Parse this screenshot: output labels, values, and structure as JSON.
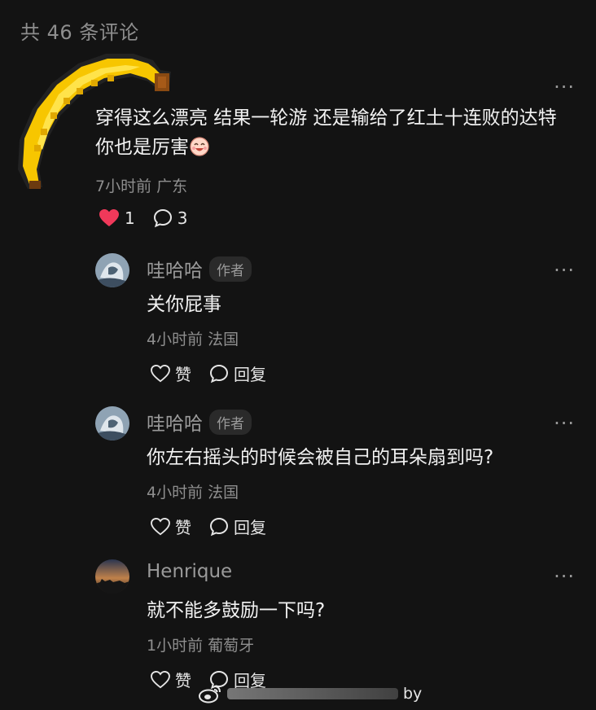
{
  "header": {
    "title": "共 46 条评论"
  },
  "main_comment": {
    "text": "穿得这么漂亮 结果一轮游 还是输给了红土十连败的达特 你也是厉害",
    "emoji": "laughing-face-emoji",
    "meta": "7小时前 广东",
    "likes": "1",
    "replies": "3",
    "more": "···"
  },
  "replies": [
    {
      "name": "哇哈哈",
      "badge": "作者",
      "text": "关你屁事",
      "meta": "4小时前 法国",
      "like_label": "赞",
      "reply_label": "回复",
      "more": "···"
    },
    {
      "name": "哇哈哈",
      "badge": "作者",
      "text": "你左右摇头的时候会被自己的耳朵扇到吗?",
      "meta": "4小时前 法国",
      "like_label": "赞",
      "reply_label": "回复",
      "more": "···"
    },
    {
      "name": "Henrique",
      "badge": "",
      "text": "就不能多鼓励一下吗?",
      "meta": "1小时前 葡萄牙",
      "like_label": "赞",
      "reply_label": "回复",
      "more": "···"
    }
  ],
  "watermark": {
    "suffix": "by"
  },
  "colors": {
    "background": "#131313",
    "heart": "#f0395a",
    "muted": "#8e8e8e"
  }
}
